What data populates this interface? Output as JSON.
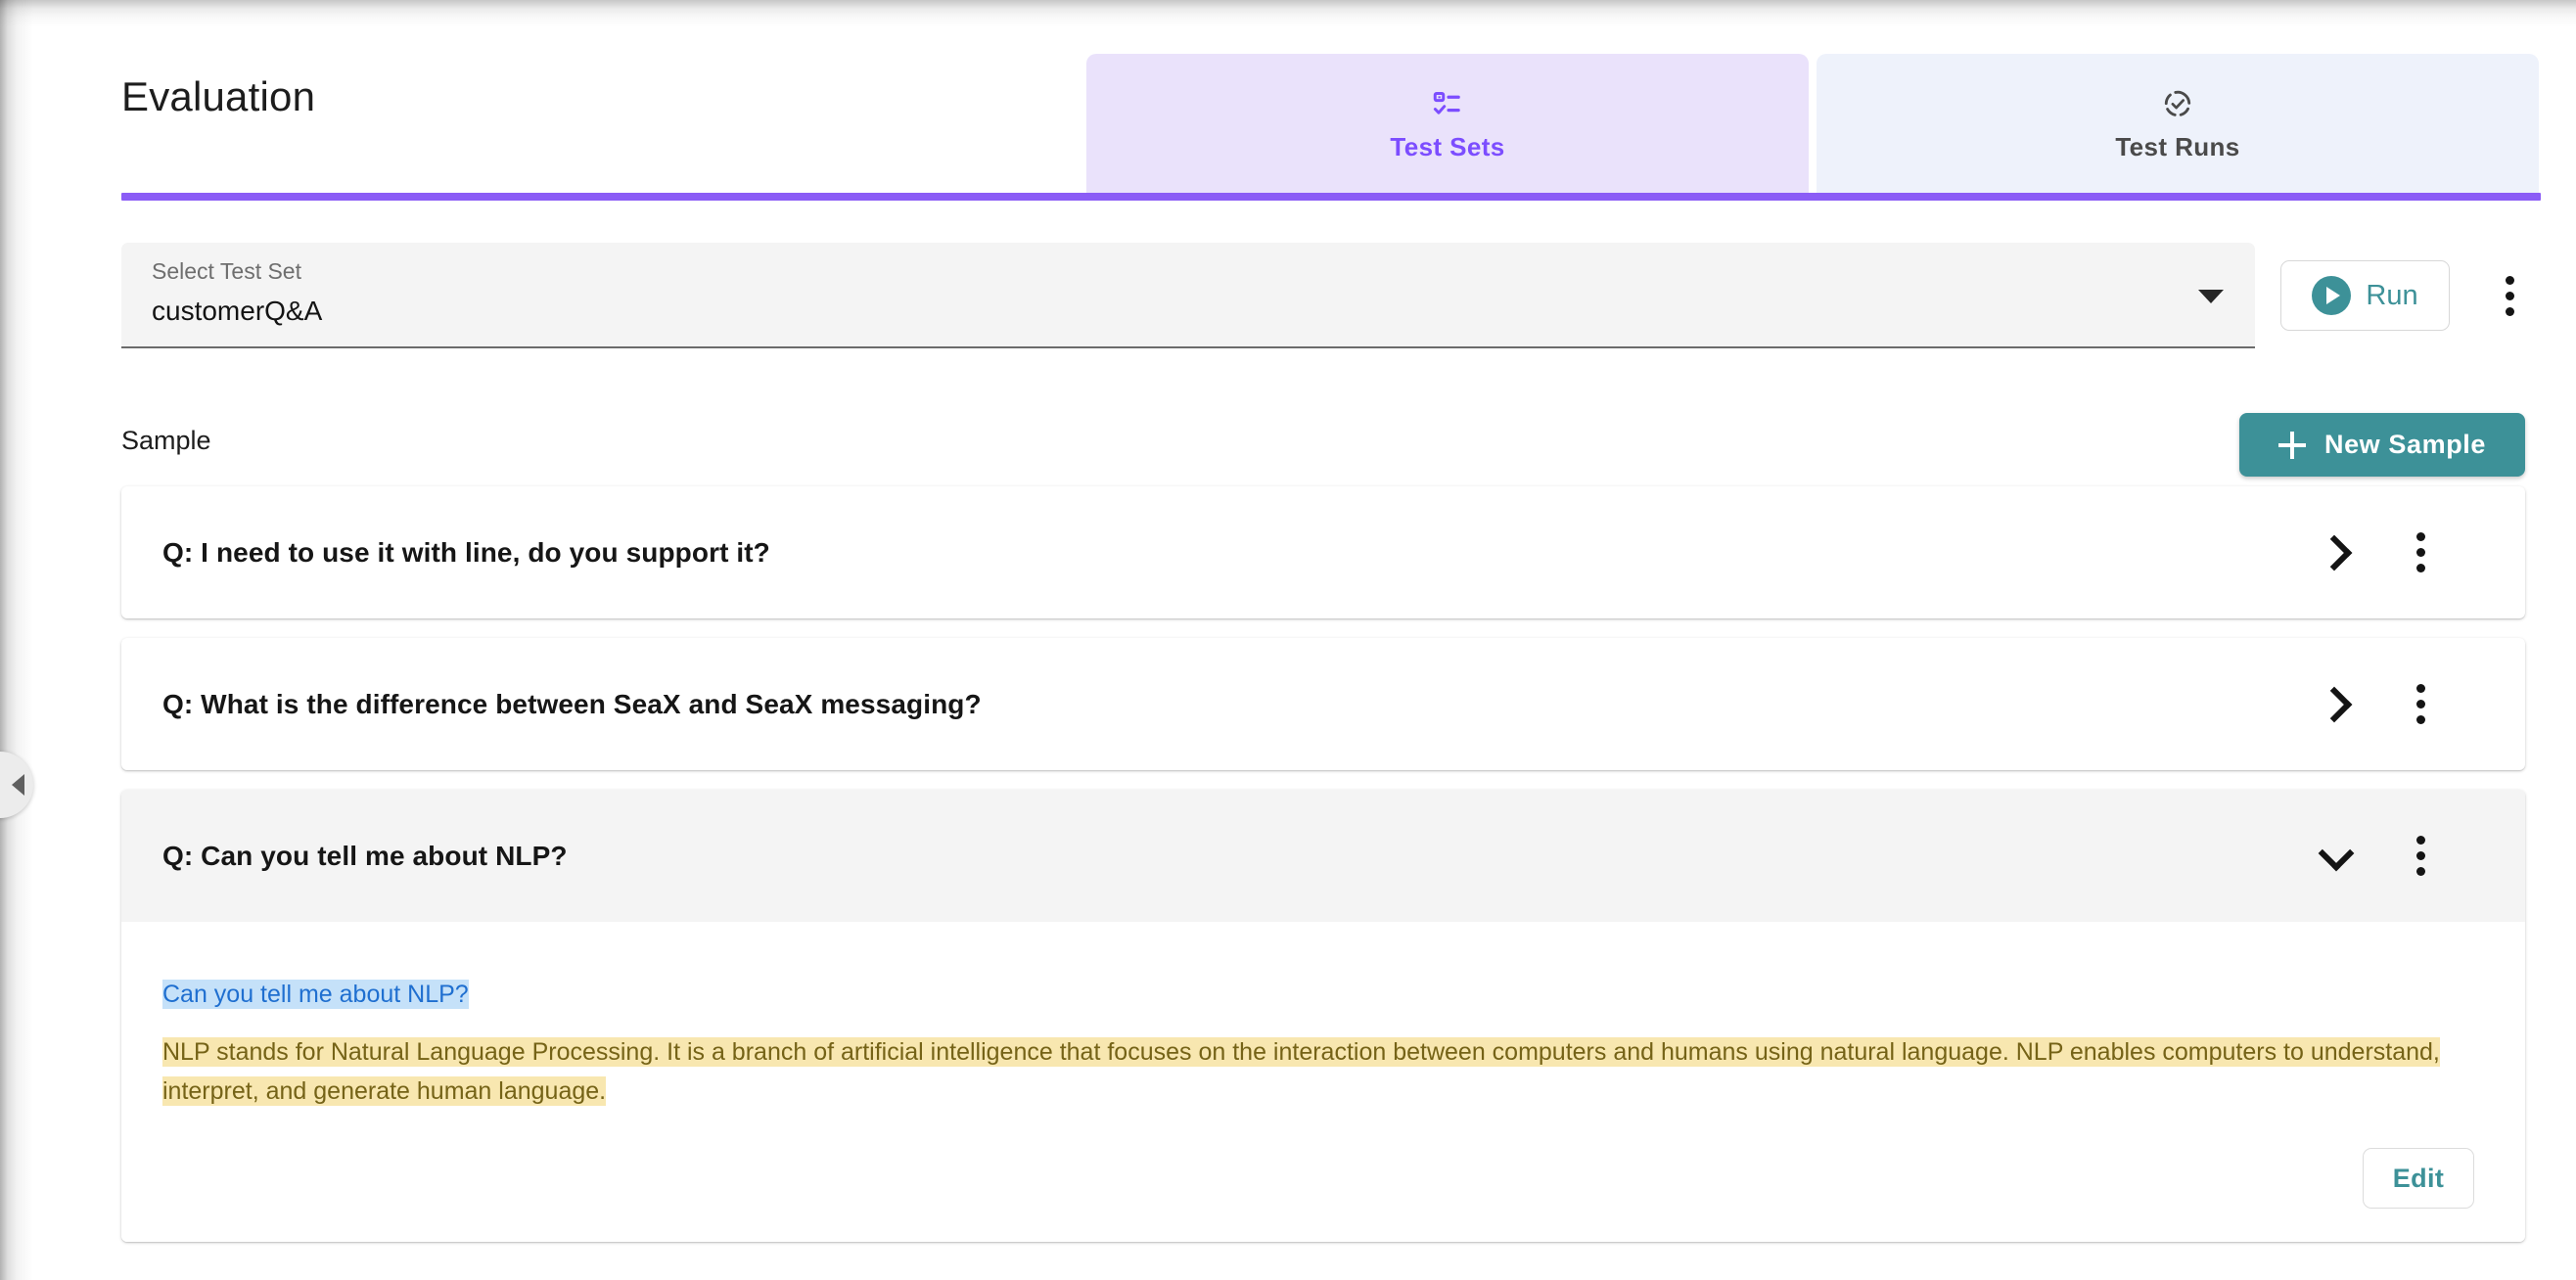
{
  "header": {
    "title": "Evaluation",
    "accent_color": "#8b5cf6",
    "tabs": [
      {
        "label": "Test Sets",
        "icon": "checklist-rule-icon",
        "active": true,
        "bg": "#eae2fb",
        "text_color": "#7c4dff"
      },
      {
        "label": "Test Runs",
        "icon": "published-with-changes-icon",
        "active": false,
        "bg": "#eef2fb",
        "text_color": "#4a4a4a"
      }
    ]
  },
  "toolbar": {
    "select": {
      "label": "Select Test Set",
      "value": "customerQ&A",
      "caret_icon": "dropdown-caret-icon"
    },
    "run_label": "Run",
    "run_icon": "play-circle-icon",
    "run_color": "#3d9198",
    "overflow_icon": "more-vertical-icon"
  },
  "sample_section": {
    "label": "Sample",
    "new_sample_label": "New Sample",
    "new_sample_icon": "plus-icon",
    "new_sample_color": "#3d9198"
  },
  "samples": [
    {
      "question": "Q: I need to use it with line, do you support it?",
      "expanded": false,
      "chevron_icon": "chevron-right-icon",
      "overflow_icon": "more-vertical-icon"
    },
    {
      "question": "Q: What is the difference between SeaX and SeaX messaging?",
      "expanded": false,
      "chevron_icon": "chevron-right-icon",
      "overflow_icon": "more-vertical-icon"
    },
    {
      "question": "Q: Can you tell me about NLP?",
      "expanded": true,
      "chevron_icon": "chevron-down-icon",
      "overflow_icon": "more-vertical-icon",
      "detail": {
        "input_text": "Can you tell me about NLP?",
        "input_highlight_bg": "#c5e1f9",
        "input_text_color": "#1f6fd0",
        "output_text": "NLP stands for Natural Language Processing. It is a branch of artificial intelligence that focuses on the interaction between computers and humans using natural language. NLP enables computers to understand, interpret, and generate human language.",
        "output_highlight_bg": "#f8e7b0",
        "output_text_color": "#756317",
        "edit_label": "Edit"
      }
    }
  ],
  "drawer": {
    "toggle_icon": "chevron-left-collapse-icon"
  }
}
